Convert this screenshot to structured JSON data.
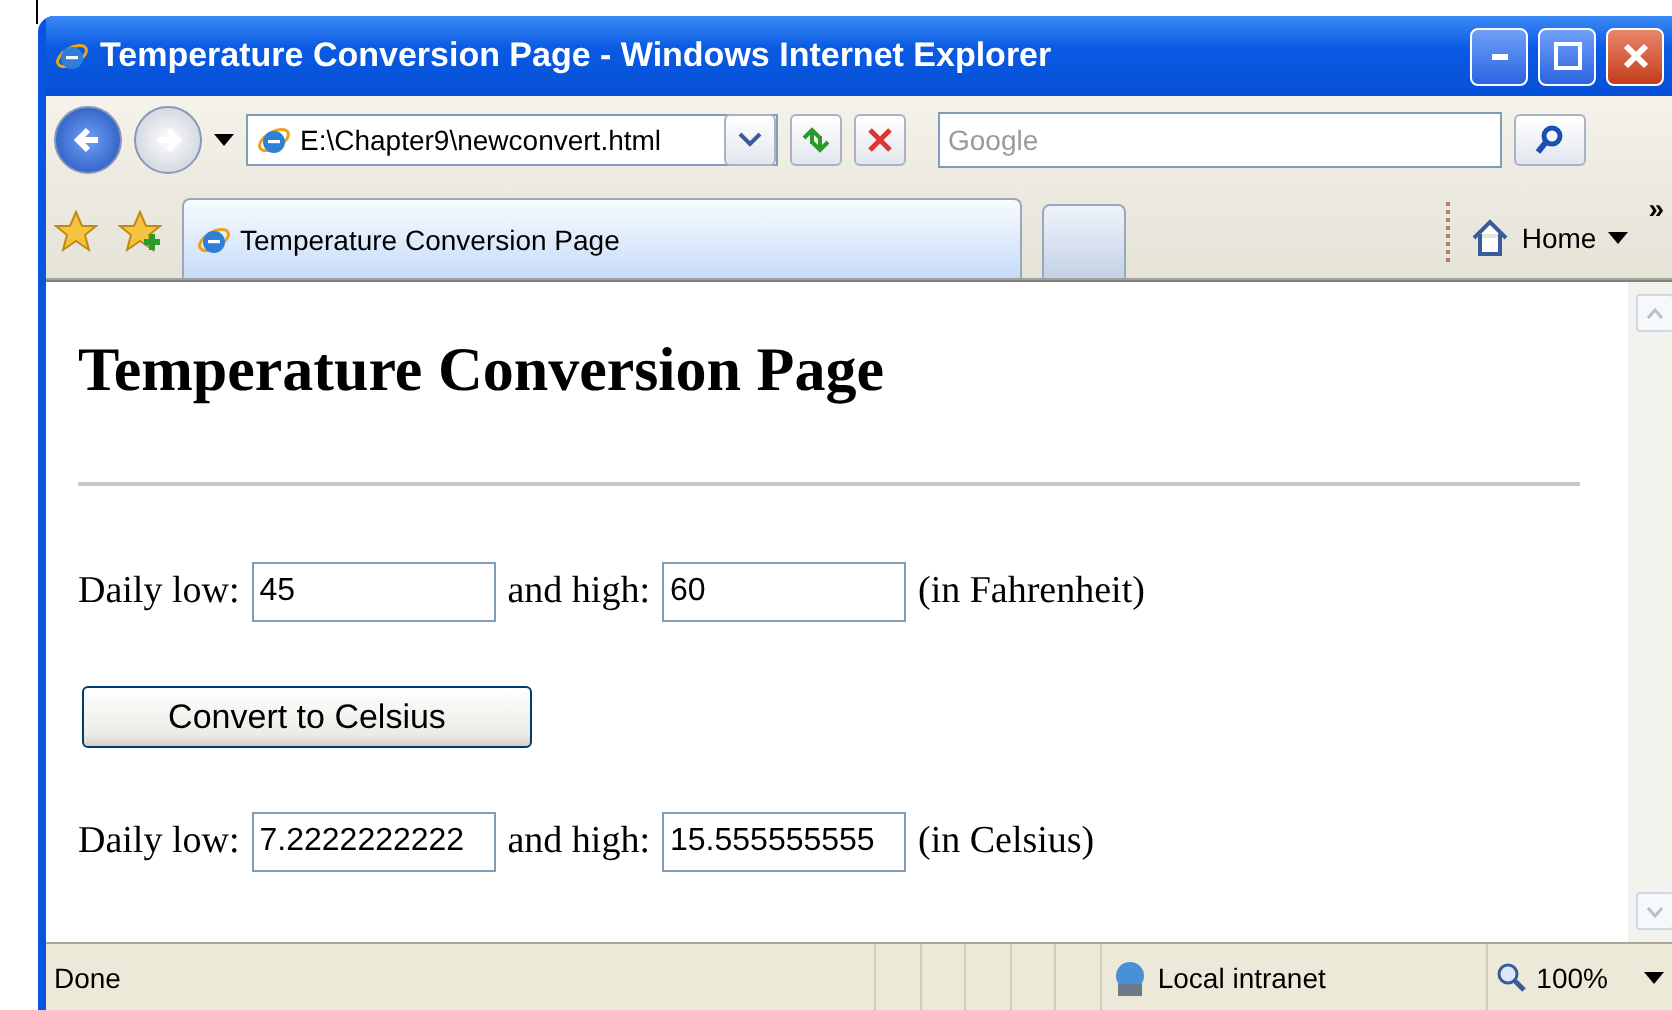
{
  "window": {
    "title": "Temperature Conversion Page - Windows Internet Explorer"
  },
  "address_bar": {
    "value": "E:\\Chapter9\\newconvert.html"
  },
  "search": {
    "placeholder": "Google"
  },
  "tabs": [
    {
      "label": "Temperature Conversion Page",
      "selected": true
    }
  ],
  "home": {
    "label": "Home"
  },
  "overflow": "»",
  "page": {
    "heading": "Temperature Conversion Page",
    "rows": [
      {
        "kind": "fields",
        "low_label": "Daily low:",
        "low": "45",
        "high_label": "and high:",
        "high": "60",
        "unit": "(in Fahrenheit)"
      },
      {
        "kind": "button",
        "label": "Convert to Celsius"
      },
      {
        "kind": "fields",
        "low_label": "Daily low:",
        "low": "7.2222222222",
        "high_label": "and high:",
        "high": "15.555555555",
        "unit": "(in Celsius)"
      }
    ]
  },
  "status_bar": {
    "status": "Done",
    "zone": "Local intranet",
    "zoom": "100%"
  }
}
